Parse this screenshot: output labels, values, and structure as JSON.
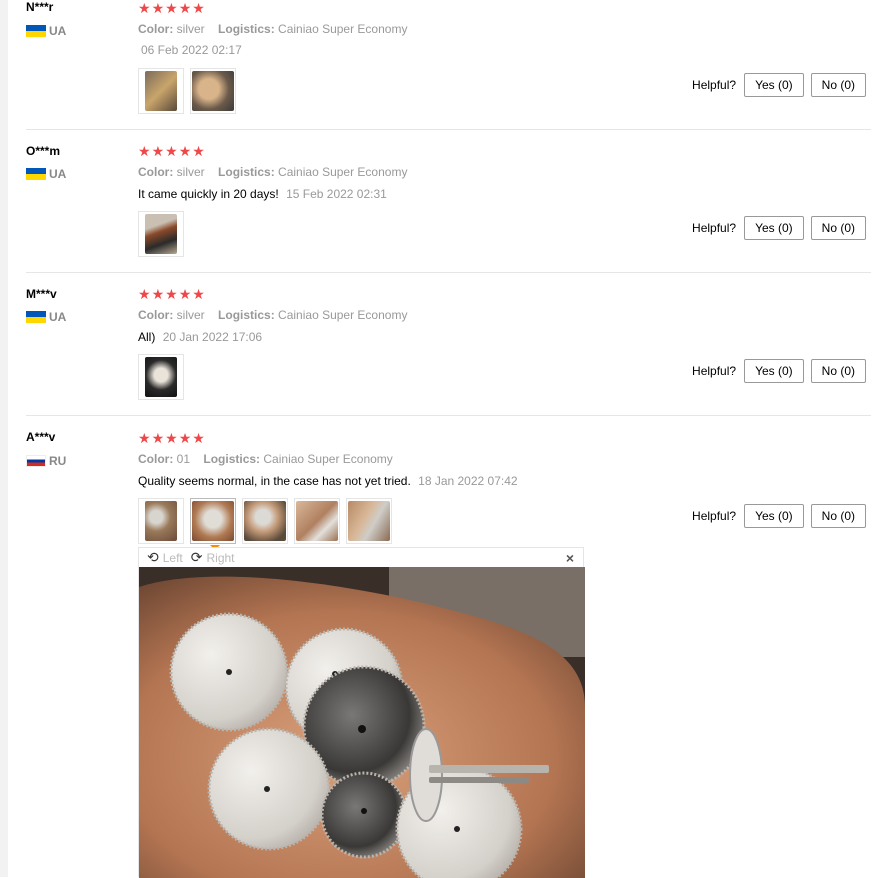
{
  "reviews": [
    {
      "user": "N***r",
      "country": "UA",
      "stars": [
        "★",
        "★",
        "★",
        "★",
        "★"
      ],
      "color_key": "Color:",
      "color_val": "silver",
      "logistics_key": "Logistics:",
      "logistics_val": "Cainiao Super Economy",
      "text": "",
      "date": "06 Feb 2022 02:17",
      "helpful": "Helpful?",
      "yes": "Yes (0)",
      "no": "No (0)"
    },
    {
      "user": "O***m",
      "country": "UA",
      "stars": [
        "★",
        "★",
        "★",
        "★",
        "★"
      ],
      "color_key": "Color:",
      "color_val": "silver",
      "logistics_key": "Logistics:",
      "logistics_val": "Cainiao Super Economy",
      "text": "It came quickly in 20 days!",
      "date": "15 Feb 2022 02:31",
      "helpful": "Helpful?",
      "yes": "Yes (0)",
      "no": "No (0)"
    },
    {
      "user": "M***v",
      "country": "UA",
      "stars": [
        "★",
        "★",
        "★",
        "★",
        "★"
      ],
      "color_key": "Color:",
      "color_val": "silver",
      "logistics_key": "Logistics:",
      "logistics_val": "Cainiao Super Economy",
      "text": "All)",
      "date": "20 Jan 2022 17:06",
      "helpful": "Helpful?",
      "yes": "Yes (0)",
      "no": "No (0)"
    },
    {
      "user": "A***v",
      "country": "RU",
      "stars": [
        "★",
        "★",
        "★",
        "★",
        "★"
      ],
      "color_key": "Color:",
      "color_val": "01",
      "logistics_key": "Logistics:",
      "logistics_val": "Cainiao Super Economy",
      "text": "Quality seems normal, in the case has not yet tried.",
      "date": "18 Jan 2022 07:42",
      "helpful": "Helpful?",
      "yes": "Yes (0)",
      "no": "No (0)"
    }
  ],
  "viewer": {
    "rotate_left": "Left",
    "rotate_right": "Right",
    "close": "×"
  },
  "colors": {
    "star": "#f04848",
    "accent": "#ff8a00"
  }
}
